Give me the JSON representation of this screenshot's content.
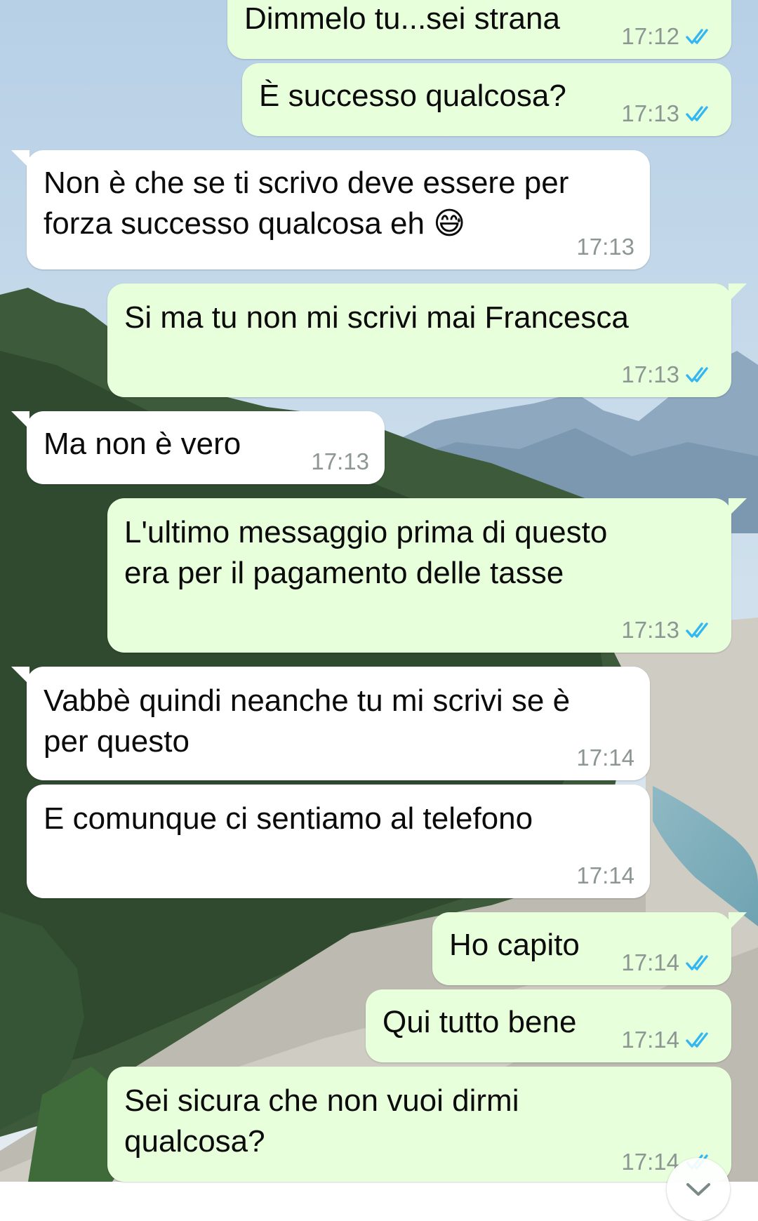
{
  "theme": {
    "outgoing_bubble": "#E7FFDB",
    "incoming_bubble": "#FFFFFF",
    "read_ticks": "#34B7F1",
    "time_text": "#8C9693"
  },
  "chat": {
    "messages": [
      {
        "direction": "outgoing",
        "text": "Dimmelo tu...sei strana",
        "time": "17:12",
        "status": "read"
      },
      {
        "direction": "outgoing",
        "text": "È successo qualcosa?",
        "time": "17:13",
        "status": "read"
      },
      {
        "direction": "incoming",
        "text": "Non è che se ti scrivo deve essere per\nforza successo qualcosa eh 😅",
        "time": "17:13"
      },
      {
        "direction": "outgoing",
        "text": "Si ma tu non mi scrivi mai Francesca",
        "time": "17:13",
        "status": "read"
      },
      {
        "direction": "incoming",
        "text": "Ma non è vero",
        "time": "17:13"
      },
      {
        "direction": "outgoing",
        "text": "L'ultimo messaggio prima di questo\nera per il pagamento delle tasse",
        "time": "17:13",
        "status": "read"
      },
      {
        "direction": "incoming",
        "text": "Vabbè quindi neanche tu mi scrivi se è\nper questo",
        "time": "17:14"
      },
      {
        "direction": "incoming",
        "text": "E comunque ci sentiamo al telefono",
        "time": "17:14"
      },
      {
        "direction": "outgoing",
        "text": "Ho capito",
        "time": "17:14",
        "status": "read"
      },
      {
        "direction": "outgoing",
        "text": "Qui tutto bene",
        "time": "17:14",
        "status": "read"
      },
      {
        "direction": "outgoing",
        "text": "Sei sicura che non vuoi dirmi\nqualcosa?",
        "time": "17:14",
        "status": "read"
      }
    ]
  }
}
